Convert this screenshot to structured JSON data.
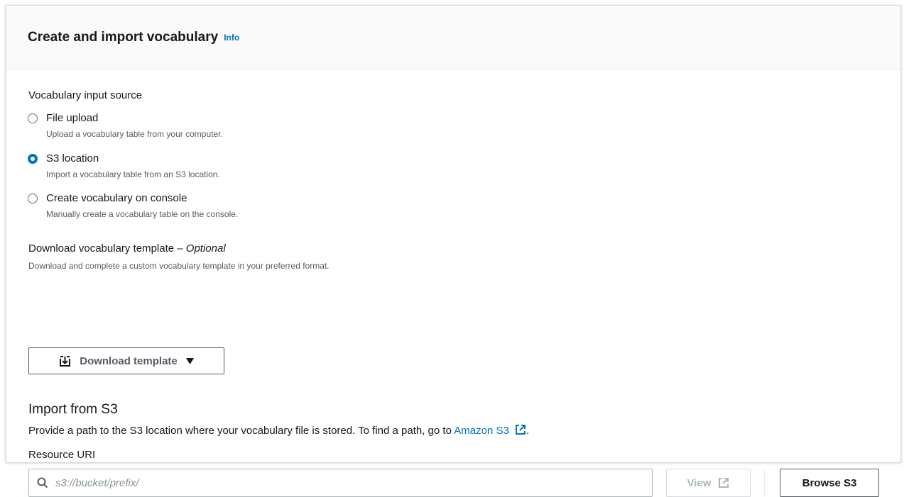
{
  "header": {
    "title": "Create and import vocabulary",
    "info": "Info"
  },
  "input_source": {
    "label": "Vocabulary input source",
    "options": [
      {
        "label": "File upload",
        "description": "Upload a vocabulary table from your computer.",
        "selected": false
      },
      {
        "label": "S3 location",
        "description": "Import a vocabulary table from an S3 location.",
        "selected": true
      },
      {
        "label": "Create vocabulary on console",
        "description": "Manually create a vocabulary table on the console.",
        "selected": false
      }
    ]
  },
  "template": {
    "label": "Download vocabulary template – ",
    "optional": "Optional",
    "description": "Download and complete a custom vocabulary template in your preferred format.",
    "button": "Download template"
  },
  "import": {
    "title": "Import from S3",
    "description": "Provide a path to the S3 location where your vocabulary file is stored. To find a path, go to ",
    "link": "Amazon S3",
    "description_end": ".",
    "resource_label": "Resource URI",
    "placeholder": "s3://bucket/prefix/",
    "value": "",
    "view_button": "View",
    "browse_button": "Browse S3"
  },
  "colors": {
    "accent": "#0073bb",
    "border": "#aab7b8",
    "text": "#16191f",
    "muted": "#545b64"
  }
}
